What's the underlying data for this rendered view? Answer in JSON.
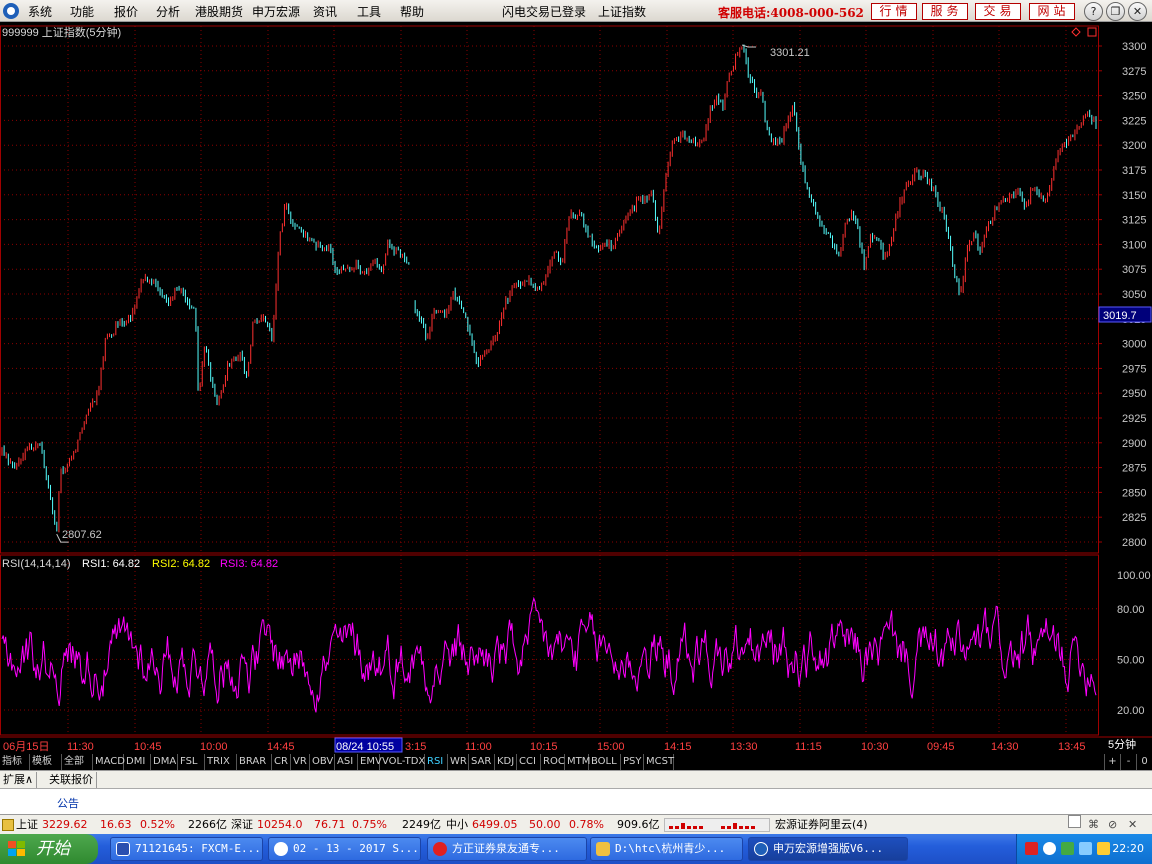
{
  "menubar": {
    "items": [
      "系统",
      "功能",
      "报价",
      "分析",
      "港股期货",
      "申万宏源",
      "资讯",
      "工具",
      "帮助"
    ],
    "login_status": "闪电交易已登录",
    "index_name": "上证指数",
    "hotline": "客服电话:4008-000-562",
    "buttons": [
      "行情",
      "服务",
      "交易",
      "网站"
    ]
  },
  "chart": {
    "header": "999999 上证指数(5分钟)",
    "price_labels": [
      "3300",
      "3275",
      "3250",
      "3225",
      "3200",
      "3175",
      "3150",
      "3125",
      "3100",
      "3075",
      "3050",
      "3025",
      "3000",
      "2975",
      "2950",
      "2925",
      "2900",
      "2875",
      "2850",
      "2825",
      "2800"
    ],
    "current_price": "3019.7",
    "max_label": "3301.21",
    "min_label": "2807.62",
    "rsi_title": "RSI(14,14,14)",
    "rsi1": "RSI1: 64.82",
    "rsi2": "RSI2: 64.82",
    "rsi3": "RSI3: 64.82",
    "rsi_labels": [
      "100.00",
      "80.00",
      "50.00",
      "20.00"
    ],
    "time_labels": [
      "06月15日",
      "11:30",
      "10:45",
      "10:00",
      "14:45",
      "08/24 10:55",
      "3:15",
      "11:00",
      "10:15",
      "15:00",
      "14:15",
      "13:30",
      "11:15",
      "10:30",
      "09:45",
      "14:30",
      "13:45"
    ],
    "period": "5分钟"
  },
  "colors": {
    "up": "#ff3030",
    "down": "#54ffff",
    "rsi": "#ff00ff",
    "grid": "#8b0000",
    "axis": "#a00000"
  },
  "chart_data": {
    "type": "line",
    "title": "999999 上证指数(5分钟)",
    "price_range": [
      2800,
      3300
    ],
    "price_path": [
      [
        0,
        2890
      ],
      [
        2,
        2875
      ],
      [
        4,
        2895
      ],
      [
        6,
        2900
      ],
      [
        7.5,
        2845
      ],
      [
        8.5,
        2808
      ],
      [
        9,
        2870
      ],
      [
        11,
        2885
      ],
      [
        13,
        2930
      ],
      [
        15,
        2950
      ],
      [
        16,
        3000
      ],
      [
        18,
        3020
      ],
      [
        20,
        3025
      ],
      [
        22,
        3068
      ],
      [
        24,
        3060
      ],
      [
        26,
        3040
      ],
      [
        27,
        3055
      ],
      [
        28,
        3050
      ],
      [
        29,
        3040
      ],
      [
        30,
        3035
      ],
      [
        30.5,
        2945
      ],
      [
        31.5,
        3000
      ],
      [
        32.5,
        2960
      ],
      [
        33.5,
        2940
      ],
      [
        35,
        2975
      ],
      [
        37,
        2990
      ],
      [
        38,
        2965
      ],
      [
        39,
        3020
      ],
      [
        41,
        3025
      ],
      [
        42,
        3005
      ],
      [
        43,
        3100
      ],
      [
        44,
        3140
      ],
      [
        45,
        3120
      ],
      [
        47,
        3110
      ],
      [
        49,
        3100
      ],
      [
        51,
        3095
      ],
      [
        52,
        3070
      ],
      [
        53,
        3075
      ],
      [
        55,
        3080
      ],
      [
        56,
        3070
      ],
      [
        58,
        3085
      ],
      [
        59,
        3075
      ],
      [
        60,
        3100
      ],
      [
        62,
        3090
      ],
      [
        63.5,
        3080
      ],
      [
        64,
        3035
      ],
      [
        65,
        3025
      ],
      [
        66,
        3005
      ],
      [
        67,
        3030
      ],
      [
        69,
        3030
      ],
      [
        70,
        3050
      ],
      [
        71,
        3045
      ],
      [
        72,
        3030
      ],
      [
        73,
        3000
      ],
      [
        74,
        2980
      ],
      [
        75,
        2990
      ],
      [
        77,
        3010
      ],
      [
        78,
        3040
      ],
      [
        80,
        3060
      ],
      [
        82,
        3065
      ],
      [
        83,
        3050
      ],
      [
        84,
        3060
      ],
      [
        85,
        3080
      ],
      [
        86,
        3090
      ],
      [
        87,
        3075
      ],
      [
        88,
        3130
      ],
      [
        90,
        3130
      ],
      [
        91,
        3110
      ],
      [
        93,
        3095
      ],
      [
        94,
        3100
      ],
      [
        95,
        3100
      ],
      [
        97,
        3130
      ],
      [
        99,
        3145
      ],
      [
        101,
        3150
      ],
      [
        102,
        3110
      ],
      [
        103,
        3160
      ],
      [
        104,
        3200
      ],
      [
        106,
        3210
      ],
      [
        108,
        3200
      ],
      [
        109,
        3205
      ],
      [
        110,
        3235
      ],
      [
        111,
        3250
      ],
      [
        112,
        3240
      ],
      [
        113,
        3270
      ],
      [
        114,
        3290
      ],
      [
        115,
        3301
      ],
      [
        116,
        3270
      ],
      [
        117,
        3255
      ],
      [
        118,
        3250
      ],
      [
        119,
        3210
      ],
      [
        120,
        3205
      ],
      [
        121,
        3200
      ],
      [
        122,
        3225
      ],
      [
        123,
        3240
      ],
      [
        124,
        3190
      ],
      [
        125,
        3160
      ],
      [
        126,
        3140
      ],
      [
        127,
        3120
      ],
      [
        128,
        3115
      ],
      [
        129,
        3100
      ],
      [
        130,
        3085
      ],
      [
        131,
        3120
      ],
      [
        132,
        3130
      ],
      [
        133,
        3115
      ],
      [
        134,
        3075
      ],
      [
        135,
        3110
      ],
      [
        136,
        3105
      ],
      [
        137,
        3090
      ],
      [
        138,
        3100
      ],
      [
        139,
        3130
      ],
      [
        140,
        3150
      ],
      [
        141,
        3165
      ],
      [
        142,
        3175
      ],
      [
        143,
        3170
      ],
      [
        144,
        3165
      ],
      [
        145,
        3150
      ],
      [
        146,
        3135
      ],
      [
        147,
        3110
      ],
      [
        148,
        3065
      ],
      [
        149,
        3050
      ],
      [
        150,
        3095
      ],
      [
        151,
        3110
      ],
      [
        152,
        3095
      ],
      [
        153,
        3115
      ],
      [
        154,
        3130
      ],
      [
        155,
        3145
      ],
      [
        157,
        3150
      ],
      [
        158,
        3155
      ],
      [
        159,
        3140
      ],
      [
        160,
        3155
      ],
      [
        161,
        3150
      ],
      [
        162,
        3140
      ],
      [
        163,
        3165
      ],
      [
        164,
        3190
      ],
      [
        165,
        3200
      ],
      [
        166,
        3210
      ],
      [
        167,
        3215
      ],
      [
        168,
        3225
      ],
      [
        169,
        3230
      ],
      [
        170,
        3220
      ]
    ],
    "rsi_range": [
      0,
      100
    ],
    "rsi_current": [
      64.82,
      64.82,
      64.82
    ],
    "rsi_levels": [
      100,
      80,
      50,
      20
    ]
  },
  "tabs": [
    "指标",
    "模板",
    "全部",
    "MACD",
    "DMI",
    "DMA",
    "FSL",
    "TRIX",
    "BRAR",
    "CR",
    "VR",
    "OBV",
    "ASI",
    "EMV",
    "VOL-TDX",
    "RSI",
    "WR",
    "SAR",
    "KDJ",
    "CCI",
    "ROC",
    "MTM",
    "BOLL",
    "PSY",
    "MCST"
  ],
  "tab_right": [
    "+",
    "-",
    "0"
  ],
  "subtabs": [
    "扩展∧",
    "关联报价"
  ],
  "notice": "公告",
  "status": {
    "sh_label": "上证",
    "sh_value": "3229.62",
    "sh_change": "16.63",
    "sh_pct": "0.52%",
    "sh_amount": "2266亿",
    "sz_label": "深证",
    "sz_value": "10254.0",
    "sz_change": "76.71",
    "sz_pct": "0.75%",
    "sz_amount": "2249亿",
    "zx_label": "中小",
    "zx_value": "6499.05",
    "zx_change": "50.00",
    "zx_pct": "0.78%",
    "zx_amount": "909.6亿",
    "cloud": "宏源证券阿里云(4)"
  },
  "taskbar": {
    "start": "开始",
    "tasks": [
      "71121645: FXCM-E...",
      "02 - 13 - 2017 S...",
      "方正证券泉友通专...",
      "D:\\htc\\杭州青少...",
      "申万宏源增强版V6..."
    ],
    "clock": "22:20"
  }
}
